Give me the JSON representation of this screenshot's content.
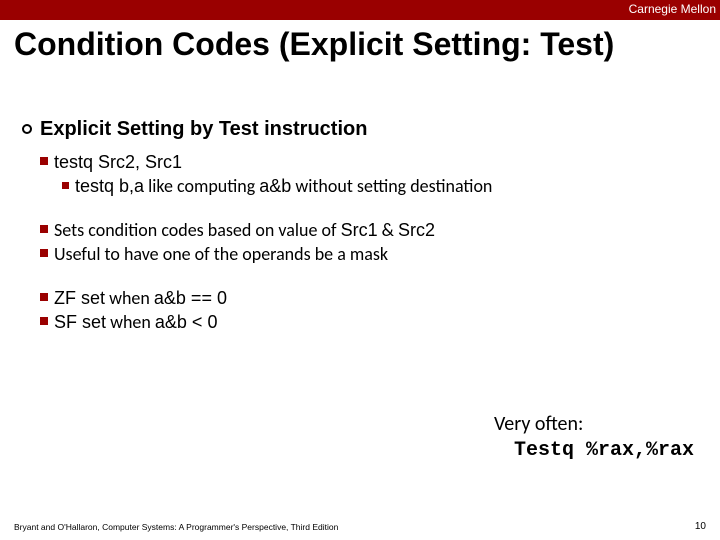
{
  "header": {
    "brand": "Carnegie Mellon"
  },
  "title": "Condition Codes (Explicit Setting: Test)",
  "sectionHeading": "Explicit Setting by Test instruction",
  "b1": {
    "line1_a": "testq",
    "line1_b": " Src2, Src1",
    "sub_a": "testq b,a",
    "sub_b": " like computing ",
    "sub_c": "a&b",
    "sub_d": " without setting destination"
  },
  "b2": {
    "line_a": "Sets condition codes based on value of ",
    "line_b": "Src1",
    "line_c": " & ",
    "line_d": "Src2"
  },
  "b3": {
    "text": "Useful to have one of the operands be a mask"
  },
  "b4": {
    "a": "ZF set",
    "b": " when ",
    "c": "a&b == 0"
  },
  "b5": {
    "a": "SF set",
    "b": " when ",
    "c": "a&b < 0"
  },
  "often": {
    "line1": "Very often:",
    "line2_a": "Testq  ",
    "line2_b": "%rax,%rax"
  },
  "footer": "Bryant and O'Hallaron, Computer Systems: A Programmer's Perspective, Third Edition",
  "pageNumber": "10"
}
